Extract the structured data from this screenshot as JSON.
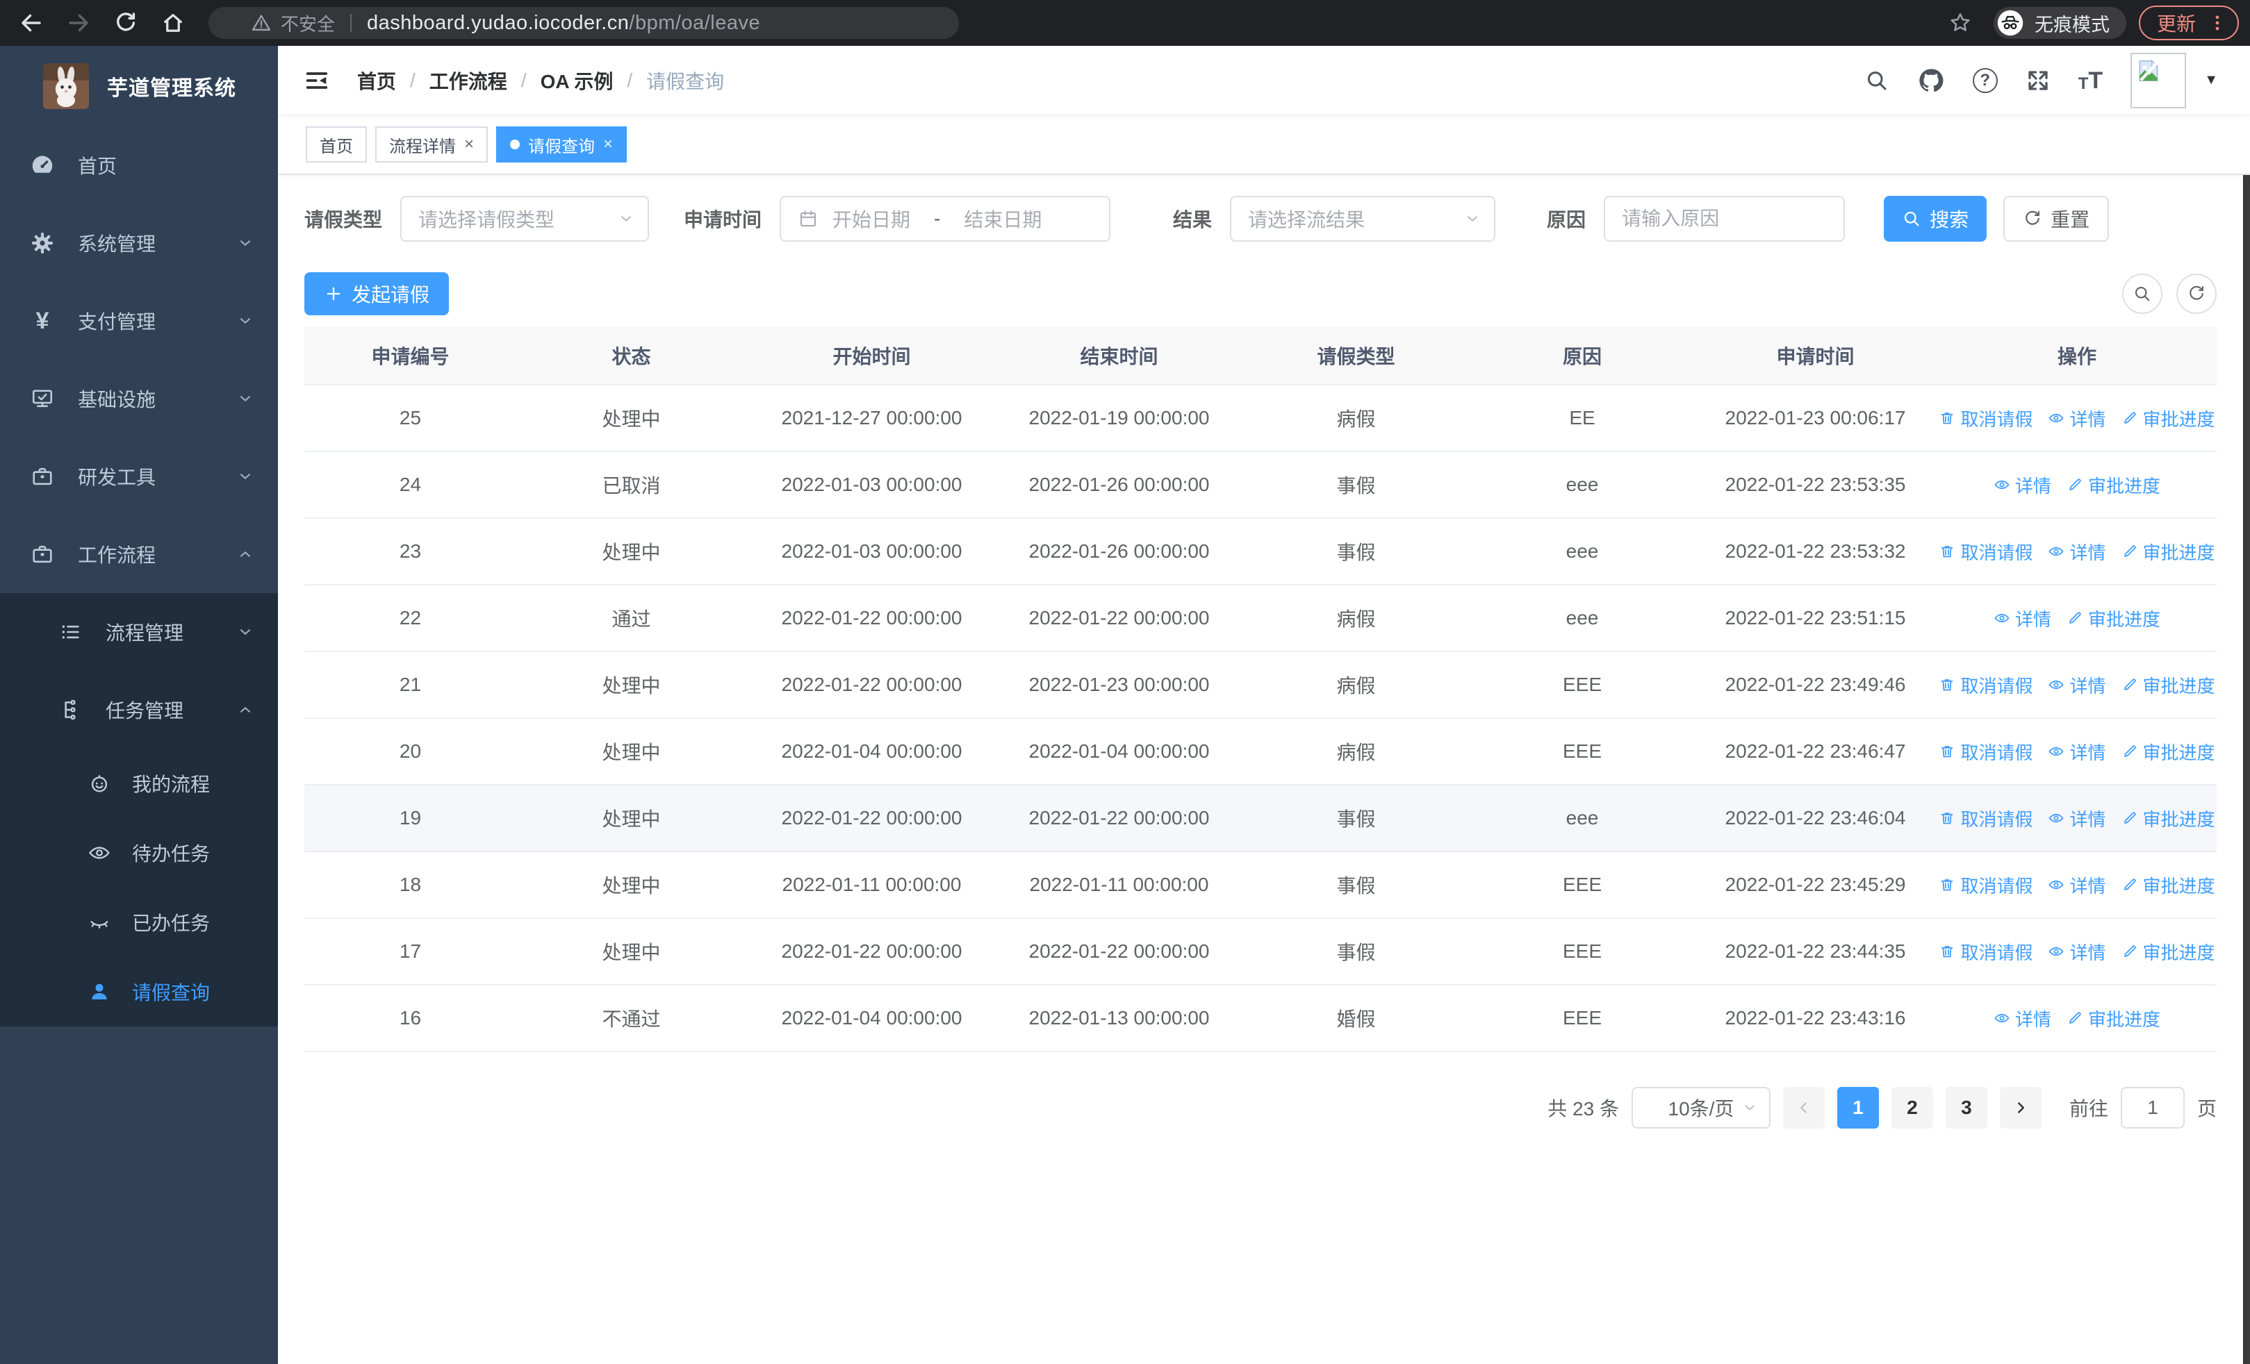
{
  "browser": {
    "security_label": "不安全",
    "url_host": "dashboard.yudao.iocoder.cn",
    "url_path": "/bpm/oa/leave",
    "incognito_label": "无痕模式",
    "update_label": "更新"
  },
  "sidebar": {
    "app_title": "芋道管理系统",
    "items": [
      {
        "label": "首页",
        "icon": "dashboard-icon"
      },
      {
        "label": "系统管理",
        "icon": "gear-icon"
      },
      {
        "label": "支付管理",
        "icon": "yen-icon"
      },
      {
        "label": "基础设施",
        "icon": "monitor-icon"
      },
      {
        "label": "研发工具",
        "icon": "toolbox-icon"
      },
      {
        "label": "工作流程",
        "icon": "briefcase-icon"
      }
    ],
    "submenu": [
      {
        "label": "流程管理",
        "icon": "list-icon"
      },
      {
        "label": "任务管理",
        "icon": "tree-icon"
      }
    ],
    "task_items": [
      {
        "label": "我的流程",
        "icon": "robot-icon"
      },
      {
        "label": "待办任务",
        "icon": "eye-open-icon"
      },
      {
        "label": "已办任务",
        "icon": "eye-closed-icon"
      },
      {
        "label": "请假查询",
        "icon": "user-icon"
      }
    ]
  },
  "header": {
    "breadcrumb": [
      "首页",
      "工作流程",
      "OA 示例",
      "请假查询"
    ],
    "separator": "/"
  },
  "tabs": [
    {
      "label": "首页"
    },
    {
      "label": "流程详情",
      "close": "×"
    },
    {
      "label": "请假查询",
      "close": "×"
    }
  ],
  "filters": {
    "leave_type_label": "请假类型",
    "leave_type_placeholder": "请选择请假类型",
    "apply_time_label": "申请时间",
    "date_start_placeholder": "开始日期",
    "date_separator": "-",
    "date_end_placeholder": "结束日期",
    "result_label": "结果",
    "result_placeholder": "请选择流结果",
    "reason_label": "原因",
    "reason_placeholder": "请输入原因",
    "search_label": "搜索",
    "reset_label": "重置"
  },
  "toolbar": {
    "create_label": "发起请假"
  },
  "table": {
    "columns": [
      "申请编号",
      "状态",
      "开始时间",
      "结束时间",
      "请假类型",
      "原因",
      "申请时间",
      "操作"
    ],
    "rows": [
      {
        "id": "25",
        "status": "处理中",
        "start": "2021-12-27 00:00:00",
        "end": "2022-01-19 00:00:00",
        "type": "病假",
        "reason": "EE",
        "apply_time": "2022-01-23 00:06:17",
        "actions": [
          "取消请假",
          "详情",
          "审批进度"
        ]
      },
      {
        "id": "24",
        "status": "已取消",
        "start": "2022-01-03 00:00:00",
        "end": "2022-01-26 00:00:00",
        "type": "事假",
        "reason": "eee",
        "apply_time": "2022-01-22 23:53:35",
        "actions": [
          "详情",
          "审批进度"
        ]
      },
      {
        "id": "23",
        "status": "处理中",
        "start": "2022-01-03 00:00:00",
        "end": "2022-01-26 00:00:00",
        "type": "事假",
        "reason": "eee",
        "apply_time": "2022-01-22 23:53:32",
        "actions": [
          "取消请假",
          "详情",
          "审批进度"
        ]
      },
      {
        "id": "22",
        "status": "通过",
        "start": "2022-01-22 00:00:00",
        "end": "2022-01-22 00:00:00",
        "type": "病假",
        "reason": "eee",
        "apply_time": "2022-01-22 23:51:15",
        "actions": [
          "详情",
          "审批进度"
        ]
      },
      {
        "id": "21",
        "status": "处理中",
        "start": "2022-01-22 00:00:00",
        "end": "2022-01-23 00:00:00",
        "type": "病假",
        "reason": "EEE",
        "apply_time": "2022-01-22 23:49:46",
        "actions": [
          "取消请假",
          "详情",
          "审批进度"
        ]
      },
      {
        "id": "20",
        "status": "处理中",
        "start": "2022-01-04 00:00:00",
        "end": "2022-01-04 00:00:00",
        "type": "病假",
        "reason": "EEE",
        "apply_time": "2022-01-22 23:46:47",
        "actions": [
          "取消请假",
          "详情",
          "审批进度"
        ]
      },
      {
        "id": "19",
        "status": "处理中",
        "start": "2022-01-22 00:00:00",
        "end": "2022-01-22 00:00:00",
        "type": "事假",
        "reason": "eee",
        "apply_time": "2022-01-22 23:46:04",
        "actions": [
          "取消请假",
          "详情",
          "审批进度"
        ]
      },
      {
        "id": "18",
        "status": "处理中",
        "start": "2022-01-11 00:00:00",
        "end": "2022-01-11 00:00:00",
        "type": "事假",
        "reason": "EEE",
        "apply_time": "2022-01-22 23:45:29",
        "actions": [
          "取消请假",
          "详情",
          "审批进度"
        ]
      },
      {
        "id": "17",
        "status": "处理中",
        "start": "2022-01-22 00:00:00",
        "end": "2022-01-22 00:00:00",
        "type": "事假",
        "reason": "EEE",
        "apply_time": "2022-01-22 23:44:35",
        "actions": [
          "取消请假",
          "详情",
          "审批进度"
        ]
      },
      {
        "id": "16",
        "status": "不通过",
        "start": "2022-01-04 00:00:00",
        "end": "2022-01-13 00:00:00",
        "type": "婚假",
        "reason": "EEE",
        "apply_time": "2022-01-22 23:43:16",
        "actions": [
          "详情",
          "审批进度"
        ]
      }
    ]
  },
  "pagination": {
    "total_label": "共 23 条",
    "page_size_label": "10条/页",
    "pages": [
      "1",
      "2",
      "3"
    ],
    "active_page": "1",
    "goto_label": "前往",
    "goto_value": "1",
    "goto_suffix": "页"
  },
  "colors": {
    "primary": "#409EFF",
    "sidebar_bg": "#304156",
    "submenu_bg": "#1f2d3d"
  }
}
